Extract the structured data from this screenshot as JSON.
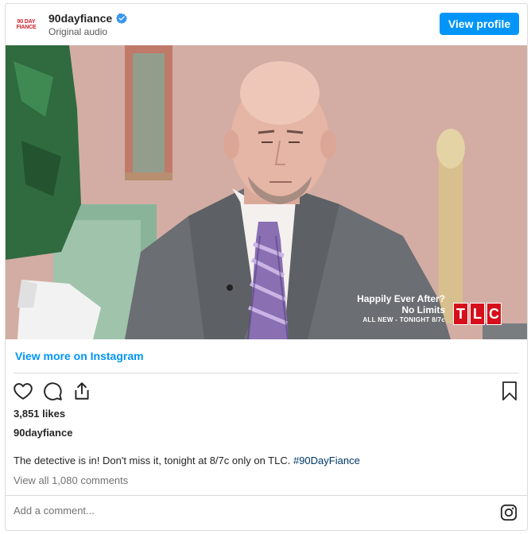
{
  "header": {
    "avatar_text": "90 DAY FIANCE",
    "username": "90dayfiance",
    "subtitle": "Original audio",
    "view_profile_label": "View profile"
  },
  "media": {
    "overlay_line1": "Happily Ever After?",
    "overlay_line2": "No Limits",
    "overlay_line3": "ALL NEW - TONIGHT 8/7c",
    "logo_letters": [
      "T",
      "L",
      "C"
    ]
  },
  "view_more_label": "View more on Instagram",
  "likes": "3,851 likes",
  "caption_username": "90dayfiance",
  "caption_text": "The detective is in! Don't miss it, tonight at 8/7c only on TLC. ",
  "caption_hashtag": "#90DayFiance",
  "view_comments_label": "View all 1,080 comments",
  "add_comment_placeholder": "Add a comment...",
  "colors": {
    "accent": "#0095f6",
    "hashtag": "#00376b",
    "tlc_red": "#d50f1b",
    "verified": "#3897f0"
  },
  "icons": [
    "verified-badge-icon",
    "heart-icon",
    "comment-icon",
    "share-icon",
    "bookmark-icon",
    "instagram-icon"
  ]
}
